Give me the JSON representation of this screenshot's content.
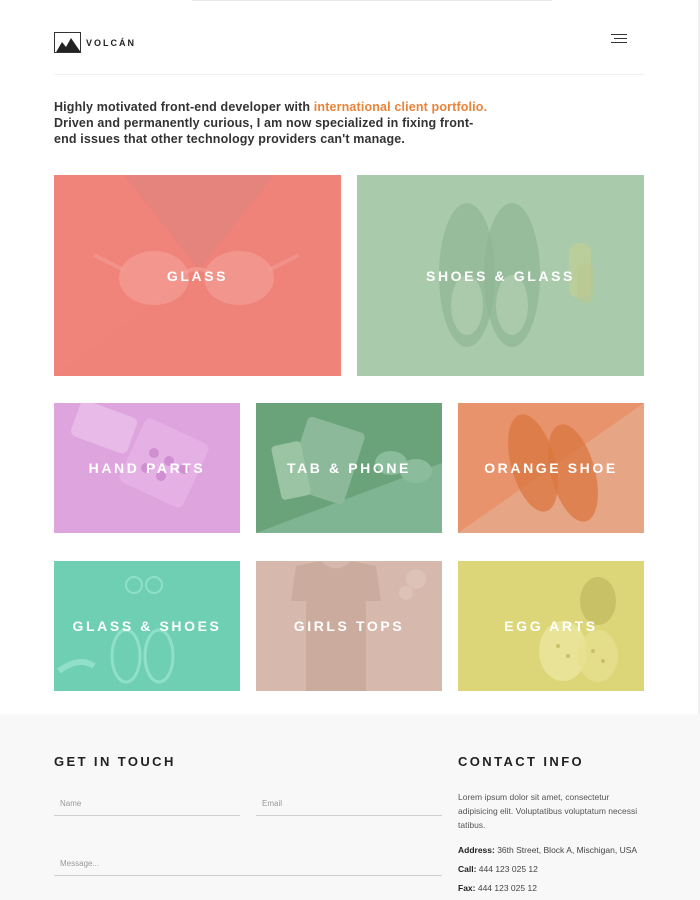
{
  "header": {
    "logo_text": "VOLCÁN",
    "menu_icon": "hamburger-icon"
  },
  "intro": {
    "text_before": "Highly motivated front-end developer with ",
    "highlight": "international client portfolio.",
    "text_after": " Driven and permanently curious, I am now specialized in fixing front-end issues that other technology providers can't manage.",
    "highlight_color": "#e8843a"
  },
  "portfolio": [
    {
      "label": "GLASS",
      "color": "#ef8279"
    },
    {
      "label": "SHOES & GLASS",
      "color": "#a9cbab"
    },
    {
      "label": "HAND PARTS",
      "color": "#dea4de"
    },
    {
      "label": "TAB & PHONE",
      "color": "#74ac86"
    },
    {
      "label": "ORANGE SHOE",
      "color": "#e79b75"
    },
    {
      "label": "GLASS & SHOES",
      "color": "#6fcfb2"
    },
    {
      "label": "GIRLS TOPS",
      "color": "#d6b8ad"
    },
    {
      "label": "EGG ARTS",
      "color": "#ddd679"
    }
  ],
  "contact_form": {
    "title": "GET IN TOUCH",
    "name_placeholder": "Name",
    "email_placeholder": "Email",
    "message_placeholder": "Message..."
  },
  "contact_info": {
    "title": "CONTACT INFO",
    "description": "Lorem ipsum dolor sit amet, consectetur adipisicing elit. Voluptatibus voluptatum necessi tatibus.",
    "address_label": "Address:",
    "address": " 36th Street, Block A, Mischigan, USA",
    "call_label": "Call:",
    "call": " 444 123 025 12",
    "fax_label": "Fax:",
    "fax": " 444 123 025 12"
  }
}
